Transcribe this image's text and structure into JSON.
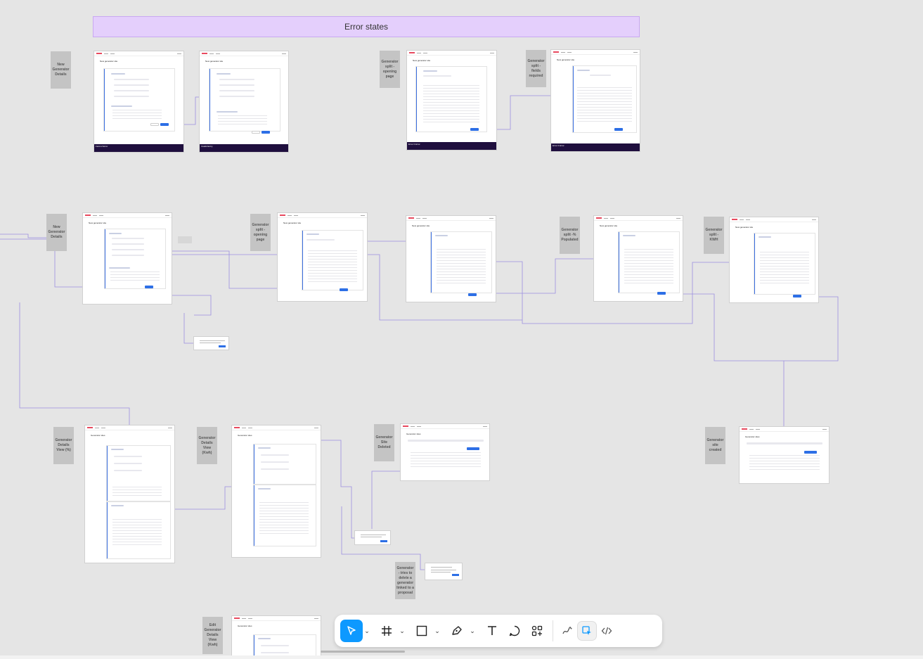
{
  "canvas": {
    "banner_title": "Error states"
  },
  "notes": {
    "new_gen_1": "New Generator Details",
    "split_opening_1": "Generator split - opening page",
    "split_fields_required": "Generator split -fields required",
    "new_gen_2": "New Generator Details",
    "split_opening_2": "Generator split - opening page",
    "split_pct_populated": "Generator split -% Populated",
    "split_kwh": "Generator split -KWH",
    "details_view_pct": "Generator Details View (%)",
    "details_view_kwh": "Generator Details View (Kwh)",
    "site_deleted": "Generator Site Deleted",
    "site_created": "Generator site created",
    "delete_linked": "Generator - tries to delete a generator linked to a proposal",
    "edit_details_kwh": "Edit Generator Details View (Kwh)"
  },
  "frames": {
    "title_new_site": "New generator site",
    "title_generator_sites": "Generator sites",
    "footer_1": "Field of Error",
    "footer_2": "Invalid Entry",
    "footer_3": "Error 0 Error",
    "footer_4": "Error 0 Error"
  },
  "toolbar": {
    "move_tool": "move-tool",
    "frame_tool": "frame-tool",
    "shape_tool": "rectangle-tool",
    "pen_tool": "pen-tool",
    "text_tool": "text-tool",
    "comment_tool": "comment-tool",
    "actions_tool": "actions-tool",
    "draw_mode": "draw-mode",
    "design_mode": "design-mode",
    "dev_mode": "dev-mode"
  },
  "colors": {
    "canvas_bg": "#e5e5e5",
    "banner_bg": "#e4cffc",
    "note_bg": "#c4c4c4",
    "primary": "#2d6fe6",
    "active_tool": "#0d99ff",
    "footer_dark": "#1f0f3e",
    "connector": "#9b8fe0"
  }
}
